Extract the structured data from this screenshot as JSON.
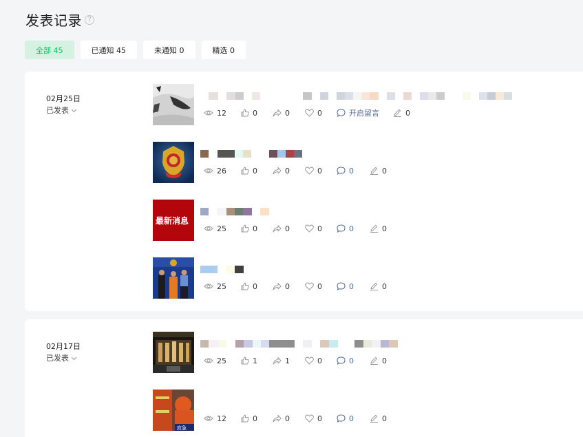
{
  "header": {
    "title": "发表记录",
    "help_icon": "?"
  },
  "tabs": [
    {
      "label": "全部 45",
      "active": true
    },
    {
      "label": "已通知 45",
      "active": false
    },
    {
      "label": "未通知 0",
      "active": false
    },
    {
      "label": "精选 0",
      "active": false
    }
  ],
  "groups": [
    {
      "date": "02月25日",
      "status": "已发表",
      "posts": [
        {
          "thumb": "ink-painting-thumb",
          "views": "12",
          "likes": "0",
          "shares": "0",
          "wows": "0",
          "comments": "开启留言",
          "edits": "0"
        },
        {
          "thumb": "police-emblem-thumb",
          "views": "26",
          "likes": "0",
          "shares": "0",
          "wows": "0",
          "comments": "0",
          "edits": "0"
        },
        {
          "thumb": "latest-news-thumb",
          "thumb_text": "最新消息",
          "views": "25",
          "likes": "0",
          "shares": "0",
          "wows": "0",
          "comments": "0",
          "edits": "0"
        },
        {
          "thumb": "group-photo-thumb",
          "views": "25",
          "likes": "0",
          "shares": "0",
          "wows": "0",
          "comments": "0",
          "edits": "0"
        }
      ]
    },
    {
      "date": "02月17日",
      "status": "已发表",
      "posts": [
        {
          "thumb": "building-night-thumb",
          "views": "25",
          "likes": "1",
          "shares": "1",
          "wows": "0",
          "comments": "0",
          "edits": "0"
        },
        {
          "thumb": "rescue-team-thumb",
          "thumb_text": "应急",
          "views": "12",
          "likes": "0",
          "shares": "0",
          "wows": "0",
          "comments": "0",
          "edits": "0"
        }
      ]
    }
  ],
  "colors": {
    "accent_green": "#07c160",
    "tab_active_bg": "#d4f1e1",
    "link_blue": "#576b95",
    "icon_gray": "#9a9a9a"
  }
}
